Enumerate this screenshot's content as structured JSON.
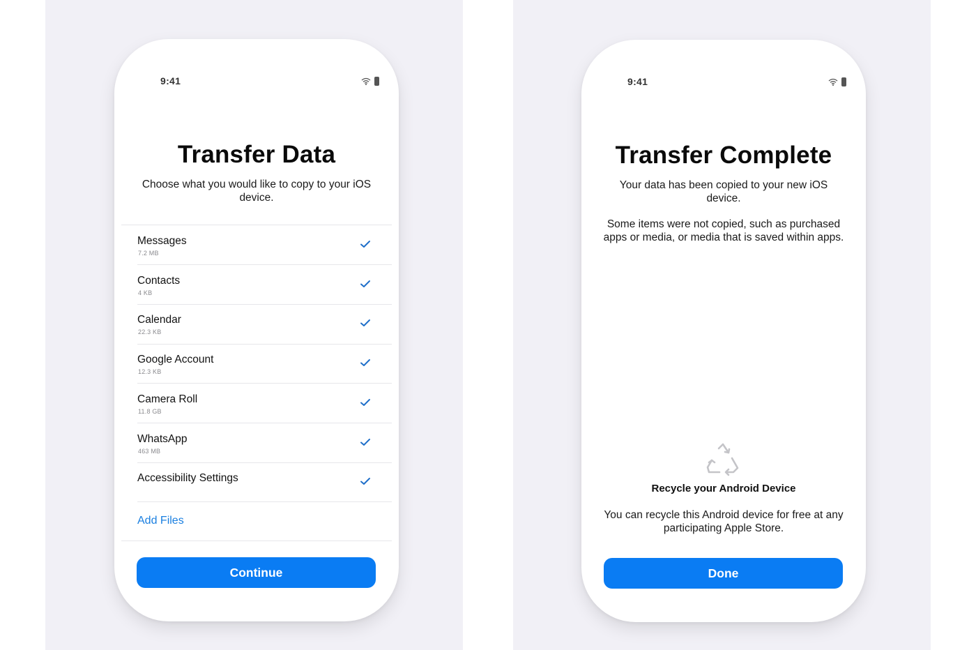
{
  "colors": {
    "background": "#f1f0f6",
    "accent": "#0a7cf3",
    "link": "#1a7fe0",
    "check": "#1f6fc9"
  },
  "screens": [
    {
      "status_bar": {
        "time": "9:41",
        "icons": [
          "wifi-icon",
          "battery-icon"
        ]
      },
      "title": "Transfer Data",
      "subtitle": "Choose what you would like to copy to your iOS device.",
      "items": [
        {
          "label": "Messages",
          "size": "7.2 MB",
          "checked": true
        },
        {
          "label": "Contacts",
          "size": "4 KB",
          "checked": true
        },
        {
          "label": "Calendar",
          "size": "22.3 KB",
          "checked": true
        },
        {
          "label": "Google Account",
          "size": "12.3 KB",
          "checked": true
        },
        {
          "label": "Camera Roll",
          "size": "11.8 GB",
          "checked": true
        },
        {
          "label": "WhatsApp",
          "size": "463 MB",
          "checked": true
        },
        {
          "label": "Accessibility Settings",
          "size": "",
          "checked": true
        }
      ],
      "add_files_label": "Add Files",
      "primary_button": "Continue"
    },
    {
      "status_bar": {
        "time": "9:41",
        "icons": [
          "wifi-icon",
          "battery-icon"
        ]
      },
      "title": "Transfer Complete",
      "subtitle": "Your data has been copied to your new iOS device.",
      "note": "Some items were not copied, such as purchased apps or media, or media that is saved within apps.",
      "recycle": {
        "icon": "recycle-icon",
        "title": "Recycle your Android Device",
        "text": "You can recycle this Android device for free at any participating Apple Store."
      },
      "primary_button": "Done"
    }
  ]
}
